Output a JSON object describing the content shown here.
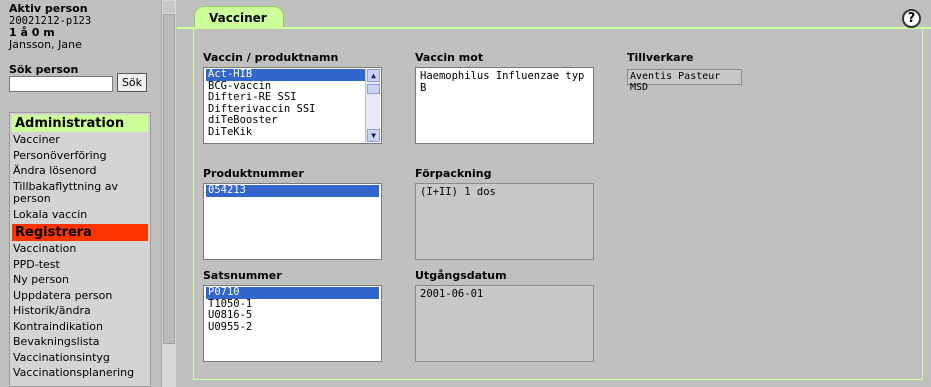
{
  "person": {
    "heading": "Aktiv person",
    "id": "20021212-p123",
    "age": "1 å 0 m",
    "name": "Jansson, Jane"
  },
  "search": {
    "label": "Sök person",
    "value": "",
    "button": "Sök"
  },
  "menu": {
    "admin_header": "Administration",
    "admin_items": [
      "Vacciner",
      "Personöverföring",
      "Ändra lösenord",
      "Tillbakaflyttning av person",
      "Lokala vaccin"
    ],
    "register_header": "Registrera",
    "register_items": [
      "Vaccination",
      "PPD-test",
      "Ny person",
      "Uppdatera person",
      "Historik/ändra",
      "Kontraindikation",
      "Bevakningslista",
      "Vaccinationsintyg",
      "Vaccinationsplanering"
    ]
  },
  "main": {
    "tab_label": "Vacciner",
    "help_label": "?",
    "vaccine_label": "Vaccin / produktnamn",
    "vaccine_options": [
      "Act-HIB",
      "BCG-vaccin",
      "Difteri-RE SSI",
      "Difterivaccin SSI",
      "diTeBooster",
      "DiTeKik"
    ],
    "vaccine_selected": "Act-HIB",
    "against_label": "Vaccin mot",
    "against_value": "Haemophilus Influenzae typ B",
    "manufacturer_label": "Tillverkare",
    "manufacturer_value": "Aventis Pasteur MSD",
    "product_number_label": "Produktnummer",
    "product_number_options": [
      "054213"
    ],
    "product_number_selected": "054213",
    "package_label": "Förpackning",
    "package_value": "(I+II) 1 dos",
    "batch_label": "Satsnummer",
    "batch_options": [
      "P0710",
      "T1050-1",
      "U0816-5",
      "U0955-2"
    ],
    "batch_selected": "P0710",
    "expiry_label": "Utgångsdatum",
    "expiry_value": "2001-06-01"
  },
  "colors": {
    "admin_header_bg": "#ccff99",
    "register_header_bg": "#ff3300",
    "selection": "#3366cc",
    "tab_bg": "#ccff99"
  }
}
